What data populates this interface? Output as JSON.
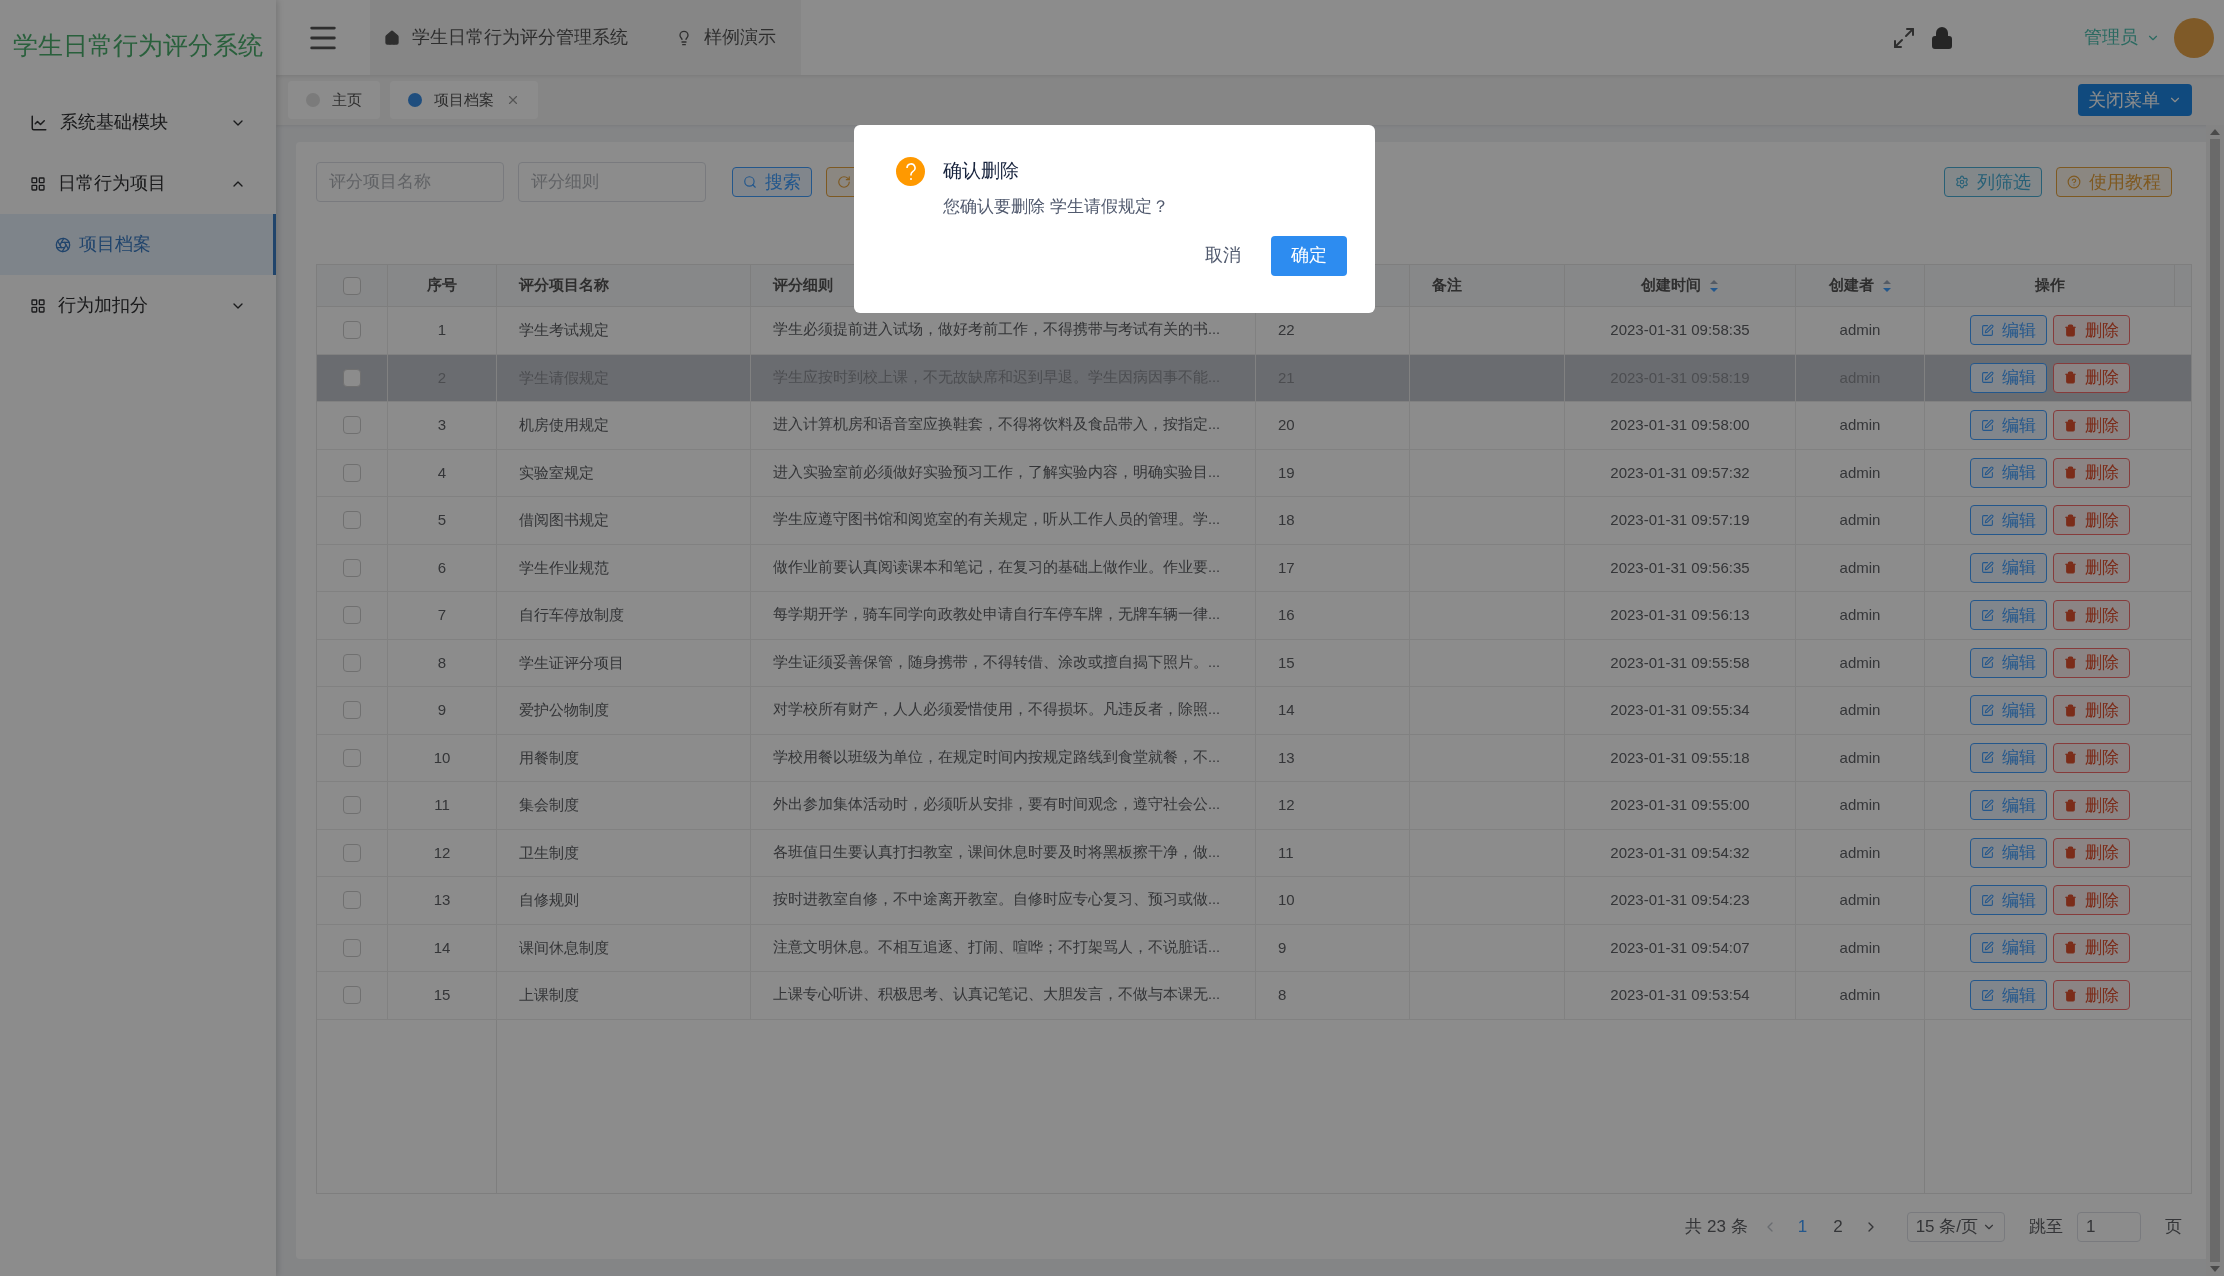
{
  "app_title": "学生日常行为评分系统",
  "sidebar": {
    "items": [
      {
        "label": "系统基础模块",
        "expanded": false
      },
      {
        "label": "日常行为项目",
        "expanded": true,
        "children": [
          {
            "label": "项目档案",
            "selected": true
          }
        ]
      },
      {
        "label": "行为加扣分",
        "expanded": false
      }
    ]
  },
  "header": {
    "breadcrumbs": [
      "学生日常行为评分管理系统",
      "样例演示"
    ],
    "user": "管理员"
  },
  "tabs": [
    {
      "label": "主页",
      "selected": false,
      "closable": false
    },
    {
      "label": "项目档案",
      "selected": true,
      "closable": true
    }
  ],
  "close_menu_button": "关闭菜单",
  "toolbar": {
    "fields": [
      {
        "placeholder": "评分项目名称"
      },
      {
        "placeholder": "评分细则"
      }
    ],
    "search_button": "搜索",
    "column_filter_button": "列筛选",
    "tutorial_button": "使用教程"
  },
  "table": {
    "select_all_checked": false,
    "columns": [
      {
        "label": "序号",
        "sortable": false
      },
      {
        "label": "评分项目名称",
        "sortable": false
      },
      {
        "label": "评分细则",
        "sortable": false
      },
      {
        "label": "备注",
        "sortable": false
      },
      {
        "label": "创建时间",
        "sortable": true
      },
      {
        "label": "创建者",
        "sortable": true
      },
      {
        "label": "操作",
        "sortable": false
      }
    ],
    "rows": [
      {
        "checked": false,
        "no": "1",
        "name": "学生考试规定",
        "detail": "学生必须提前进入试场，做好考前工作，不得携带与考试有关的书...",
        "column_4": "22",
        "created": "2023-01-31 09:58:35",
        "creator": "admin",
        "edit": "编辑",
        "delete": "删除",
        "selected": false
      },
      {
        "checked": false,
        "no": "2",
        "name": "学生请假规定",
        "detail": "学生应按时到校上课，不无故缺席和迟到早退。学生因病因事不能...",
        "column_4": "21",
        "created": "2023-01-31 09:58:19",
        "creator": "admin",
        "edit": "编辑",
        "delete": "删除",
        "selected": true
      },
      {
        "checked": false,
        "no": "3",
        "name": "机房使用规定",
        "detail": "进入计算机房和语音室应换鞋套，不得将饮料及食品带入，按指定...",
        "column_4": "20",
        "created": "2023-01-31 09:58:00",
        "creator": "admin",
        "edit": "编辑",
        "delete": "删除",
        "selected": false
      },
      {
        "checked": false,
        "no": "4",
        "name": "实验室规定",
        "detail": "进入实验室前必须做好实验预习工作，了解实验内容，明确实验目...",
        "column_4": "19",
        "created": "2023-01-31 09:57:32",
        "creator": "admin",
        "edit": "编辑",
        "delete": "删除",
        "selected": false
      },
      {
        "checked": false,
        "no": "5",
        "name": "借阅图书规定",
        "detail": "学生应遵守图书馆和阅览室的有关规定，听从工作人员的管理。学...",
        "column_4": "18",
        "created": "2023-01-31 09:57:19",
        "creator": "admin",
        "edit": "编辑",
        "delete": "删除",
        "selected": false
      },
      {
        "checked": false,
        "no": "6",
        "name": "学生作业规范",
        "detail": "做作业前要认真阅读课本和笔记，在复习的基础上做作业。作业要...",
        "column_4": "17",
        "created": "2023-01-31 09:56:35",
        "creator": "admin",
        "edit": "编辑",
        "delete": "删除",
        "selected": false
      },
      {
        "checked": false,
        "no": "7",
        "name": "自行车停放制度",
        "detail": "每学期开学，骑车同学向政教处申请自行车停车牌，无牌车辆一律...",
        "column_4": "16",
        "created": "2023-01-31 09:56:13",
        "creator": "admin",
        "edit": "编辑",
        "delete": "删除",
        "selected": false
      },
      {
        "checked": false,
        "no": "8",
        "name": "学生证评分项目",
        "detail": "学生证须妥善保管，随身携带，不得转借、涂改或擅自揭下照片。...",
        "column_4": "15",
        "created": "2023-01-31 09:55:58",
        "creator": "admin",
        "edit": "编辑",
        "delete": "删除",
        "selected": false
      },
      {
        "checked": false,
        "no": "9",
        "name": "爱护公物制度",
        "detail": "对学校所有财产，人人必须爱惜使用，不得损坏。凡违反者，除照...",
        "column_4": "14",
        "created": "2023-01-31 09:55:34",
        "creator": "admin",
        "edit": "编辑",
        "delete": "删除",
        "selected": false
      },
      {
        "checked": false,
        "no": "10",
        "name": "用餐制度",
        "detail": "学校用餐以班级为单位，在规定时间内按规定路线到食堂就餐，不...",
        "column_4": "13",
        "created": "2023-01-31 09:55:18",
        "creator": "admin",
        "edit": "编辑",
        "delete": "删除",
        "selected": false
      },
      {
        "checked": false,
        "no": "11",
        "name": "集会制度",
        "detail": "外出参加集体活动时，必须听从安排，要有时间观念，遵守社会公...",
        "column_4": "12",
        "created": "2023-01-31 09:55:00",
        "creator": "admin",
        "edit": "编辑",
        "delete": "删除",
        "selected": false
      },
      {
        "checked": false,
        "no": "12",
        "name": "卫生制度",
        "detail": "各班值日生要认真打扫教室，课间休息时要及时将黑板擦干净，做...",
        "column_4": "11",
        "created": "2023-01-31 09:54:32",
        "creator": "admin",
        "edit": "编辑",
        "delete": "删除",
        "selected": false
      },
      {
        "checked": false,
        "no": "13",
        "name": "自修规则",
        "detail": "按时进教室自修，不中途离开教室。自修时应专心复习、预习或做...",
        "column_4": "10",
        "created": "2023-01-31 09:54:23",
        "creator": "admin",
        "edit": "编辑",
        "delete": "删除",
        "selected": false
      },
      {
        "checked": false,
        "no": "14",
        "name": "课间休息制度",
        "detail": "注意文明休息。不相互追逐、打闹、喧哗；不打架骂人，不说脏话...",
        "column_4": "9",
        "created": "2023-01-31 09:54:07",
        "creator": "admin",
        "edit": "编辑",
        "delete": "删除",
        "selected": false
      },
      {
        "checked": false,
        "no": "15",
        "name": "上课制度",
        "detail": "上课专心听讲、积极思考、认真记笔记、大胆发言，不做与本课无...",
        "column_4": "8",
        "created": "2023-01-31 09:53:54",
        "creator": "admin",
        "edit": "编辑",
        "delete": "删除",
        "selected": false
      }
    ]
  },
  "pagination": {
    "total": "共 23 条",
    "pages": [
      {
        "label": "1",
        "selected": true
      },
      {
        "label": "2",
        "selected": false
      }
    ],
    "page_size": "15 条/页",
    "goto_label": "跳至",
    "goto_value": "1",
    "page_unit": "页"
  },
  "dialog": {
    "title": "确认删除",
    "message": "您确认要删除 学生请假规定？",
    "cancel": "取消",
    "confirm": "确定"
  }
}
